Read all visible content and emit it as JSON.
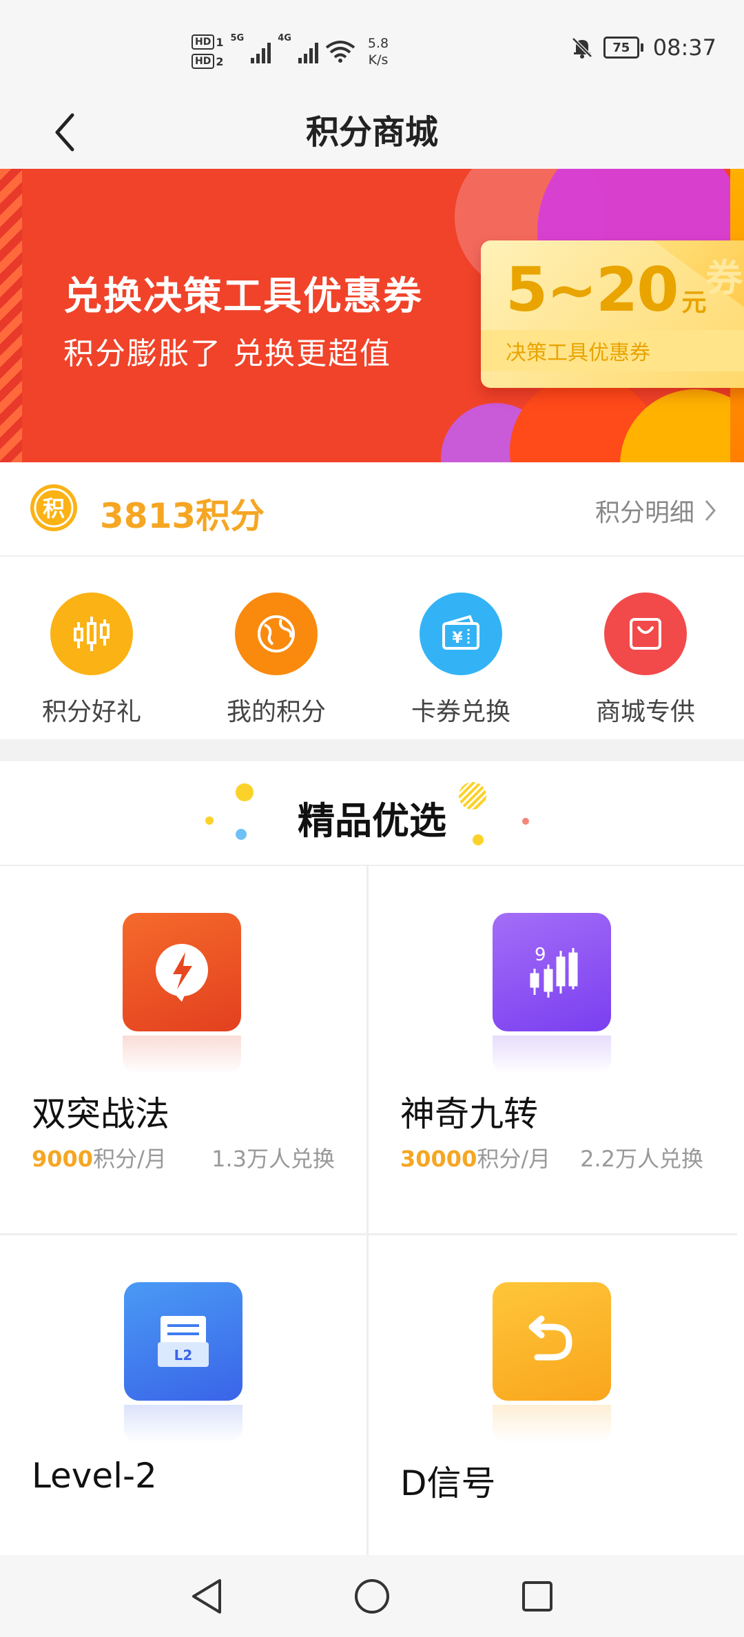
{
  "status_bar": {
    "hd1": "HD",
    "hd1_sub": "1",
    "hd2": "HD",
    "hd2_sub": "2",
    "net1": "5G",
    "net2": "4G",
    "speed_value": "5.8",
    "speed_unit": "K/s",
    "battery": "75",
    "time": "08:37",
    "icons": [
      "signal-icon",
      "wifi-icon",
      "mute-bell-icon",
      "battery-icon"
    ]
  },
  "header": {
    "title": "积分商城",
    "back_icon": "chevron-left-icon"
  },
  "banner": {
    "headline": "兑换决策工具优惠券",
    "subline": "积分膨胀了 兑换更超值",
    "coupon_amount": "5~20",
    "coupon_unit": "元",
    "coupon_label": "决策工具优惠券",
    "coupon_stamp": "券"
  },
  "points": {
    "coin_glyph": "积",
    "value": "3813积分",
    "detail_label": "积分明细"
  },
  "quick_menu": [
    {
      "label": "积分好礼",
      "icon": "candlestick-icon",
      "color": "#fbb215"
    },
    {
      "label": "我的积分",
      "icon": "globe-icon",
      "color": "#f98a0d"
    },
    {
      "label": "卡券兑换",
      "icon": "wallet-yen-icon",
      "color": "#33b3f6"
    },
    {
      "label": "商城专供",
      "icon": "shopping-bag-icon",
      "color": "#f24a4a"
    }
  ],
  "section": {
    "title": "精品优选"
  },
  "products": [
    {
      "name": "双突战法",
      "price": "9000",
      "unit": "积分/月",
      "exchanges": "1.3万人兑换",
      "icon": "lightning-bubble-icon",
      "color": "#ea4a1f"
    },
    {
      "name": "神奇九转",
      "price": "30000",
      "unit": "积分/月",
      "exchanges": "2.2万人兑换",
      "icon": "nine-candles-icon",
      "color": "#8a4df2"
    },
    {
      "name": "Level-2",
      "icon": "l2-box-icon",
      "color": "#3f7cf0"
    },
    {
      "name": "D信号",
      "icon": "d-signal-icon",
      "color": "#fbb32a"
    }
  ],
  "nav_bar": {
    "icons": [
      "back-triangle-icon",
      "home-circle-icon",
      "recents-square-icon"
    ]
  }
}
